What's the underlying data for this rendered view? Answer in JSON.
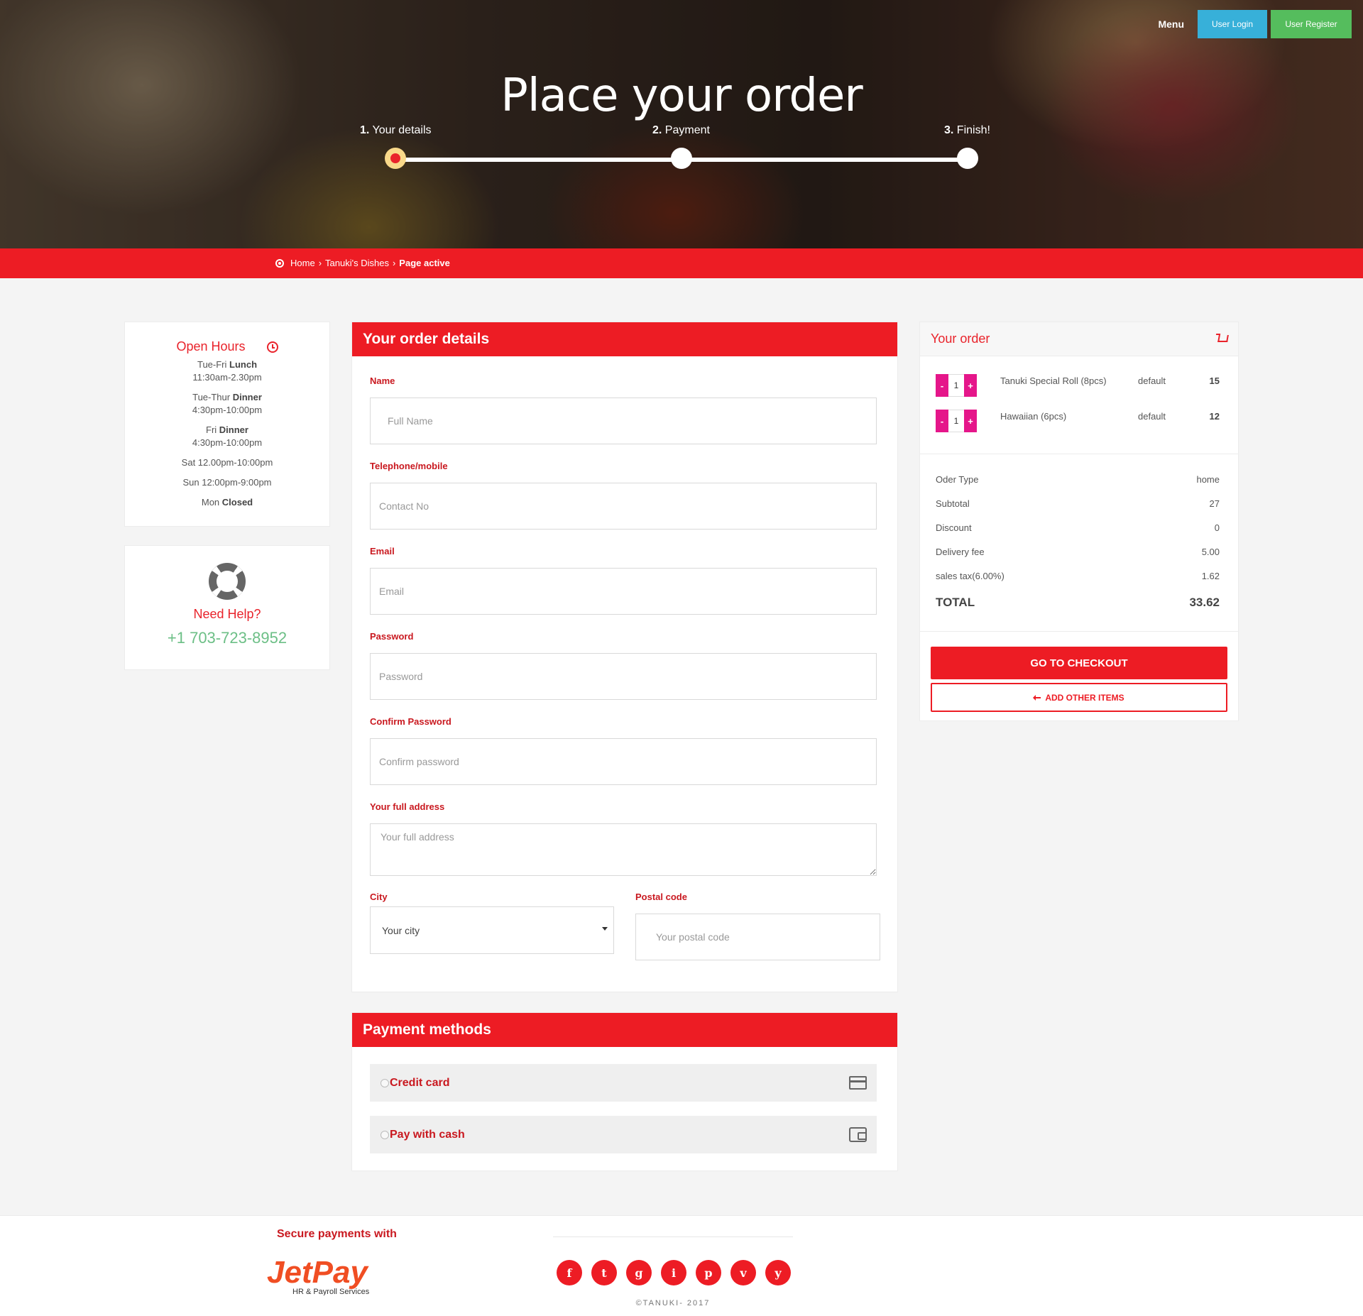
{
  "hero": {
    "title": "Place your order",
    "nav": {
      "menu": "Menu",
      "login": "User Login",
      "register": "User Register"
    },
    "steps": [
      {
        "num": "1.",
        "label": "Your details",
        "active": true
      },
      {
        "num": "2.",
        "label": "Payment",
        "active": false
      },
      {
        "num": "3.",
        "label": "Finish!",
        "active": false
      }
    ]
  },
  "breadcrumb": {
    "home": "Home",
    "sep": "›",
    "middle": "Tanuki's Dishes",
    "active": "Page active"
  },
  "hours": {
    "title": "Open Hours",
    "rows": [
      {
        "day": "Tue-Fri ",
        "meal": "Lunch",
        "time": "11:30am-2.30pm"
      },
      {
        "day": "Tue-Thur ",
        "meal": "Dinner",
        "time": "4:30pm-10:00pm"
      },
      {
        "day": "Fri ",
        "meal": "Dinner",
        "time": "4:30pm-10:00pm"
      }
    ],
    "sat": "Sat 12.00pm-10:00pm",
    "sun": "Sun 12:00pm-9:00pm",
    "mon_day": "Mon ",
    "mon_status": "Closed"
  },
  "help": {
    "title": "Need Help?",
    "phone": "+1 703-723-8952"
  },
  "details": {
    "title": "Your order details",
    "name_label": "Name",
    "name_ph": "Full Name",
    "tel_label": "Telephone/mobile",
    "tel_ph": "Contact No",
    "email_label": "Email",
    "email_ph": "Email",
    "pass_label": "Password",
    "pass_ph": "Password",
    "confirm_label": "Confirm Password",
    "confirm_ph": "Confirm password",
    "address_label": "Your full address",
    "address_ph": "Your full address",
    "city_label": "City",
    "city_value": "Your city",
    "postal_label": "Postal code",
    "postal_ph": "Your postal code"
  },
  "payment": {
    "title": "Payment methods",
    "credit": "Credit card",
    "cash": "Pay with cash"
  },
  "order": {
    "title": "Your order",
    "items": [
      {
        "qty": "1",
        "name": "Tanuki Special Roll (8pcs)",
        "option": "default",
        "price": "15"
      },
      {
        "qty": "1",
        "name": "Hawaiian (6pcs)",
        "option": "default",
        "price": "12"
      }
    ],
    "minus": "-",
    "plus": "+",
    "summary": [
      {
        "label": "Oder Type",
        "value": "home"
      },
      {
        "label": "Subtotal",
        "value": "27"
      },
      {
        "label": "Discount",
        "value": "0"
      },
      {
        "label": "Delivery fee",
        "value": "5.00"
      },
      {
        "label": "sales tax(6.00%)",
        "value": "1.62"
      }
    ],
    "total_label": "TOTAL",
    "total_value": "33.62",
    "checkout": "GO TO CHECKOUT",
    "add_items": "ADD OTHER ITEMS"
  },
  "footer": {
    "secure": "Secure payments with",
    "logo_text": "JetPay",
    "logo_sub": "HR & Payroll Services",
    "socials": [
      "f",
      "t",
      "g",
      "i",
      "p",
      "v",
      "y"
    ],
    "copyright": "©TANUKI- 2017"
  }
}
